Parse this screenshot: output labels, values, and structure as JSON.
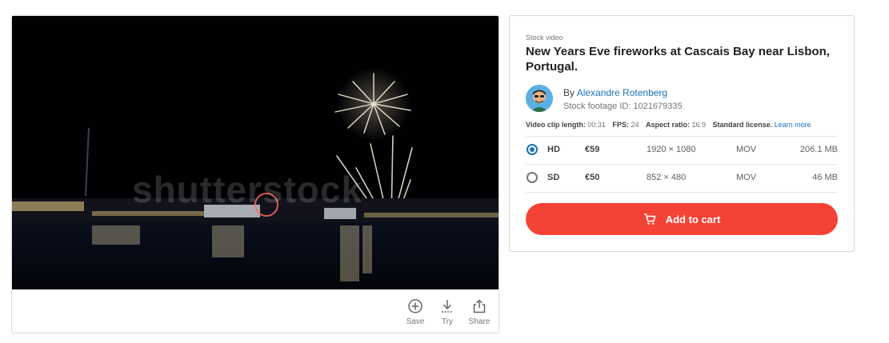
{
  "media": {
    "watermark": "shutterstock",
    "actions": {
      "save": "Save",
      "try": "Try",
      "share": "Share"
    }
  },
  "product": {
    "kicker": "Stock video",
    "title": "New Years Eve fireworks at Cascais Bay near Lisbon, Portugal.",
    "by_prefix": "By",
    "author": "Alexandre Rotenberg",
    "footage_id": "Stock footage ID: 1021679335",
    "meta": {
      "length_label": "Video clip length:",
      "length_value": "00:31",
      "fps_label": "FPS:",
      "fps_value": "24",
      "aspect_label": "Aspect ratio:",
      "aspect_value": "16:9",
      "license_label": "Standard license.",
      "learn_more": "Learn more"
    },
    "options": [
      {
        "name": "HD",
        "price": "€59",
        "resolution": "1920 × 1080",
        "format": "MOV",
        "size": "206.1 MB",
        "selected": true
      },
      {
        "name": "SD",
        "price": "€50",
        "resolution": "852 × 480",
        "format": "MOV",
        "size": "46 MB",
        "selected": false
      }
    ],
    "cart_label": "Add to cart"
  },
  "colors": {
    "accent": "#1a73b8",
    "cart": "#f44336"
  }
}
